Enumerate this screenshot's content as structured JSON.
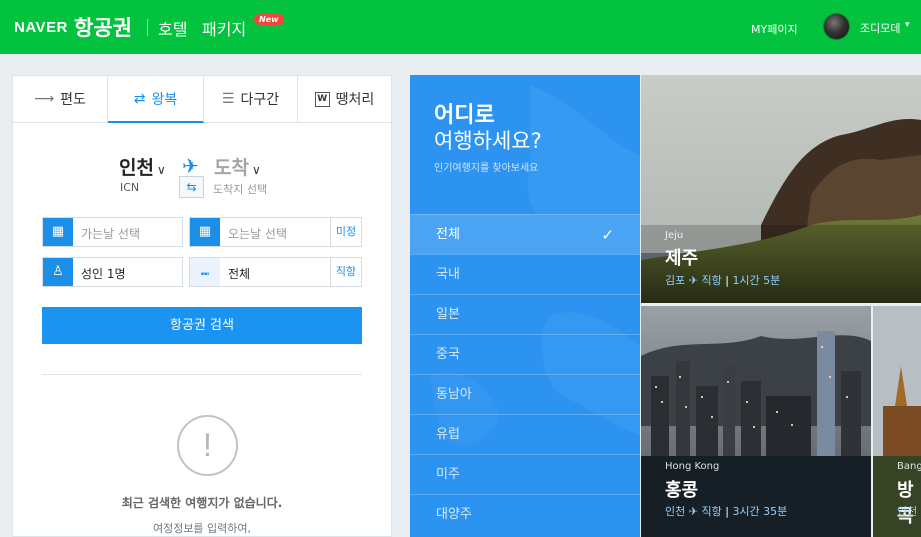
{
  "header": {
    "logo": "NAVER",
    "service": "항공권",
    "nav": [
      "호텔",
      "패키지"
    ],
    "new_badge": "New",
    "mypage": "MY페이지",
    "user": "조디모데"
  },
  "tabs": [
    {
      "label": "편도",
      "icon": "arrow-right-icon"
    },
    {
      "label": "왕복",
      "icon": "round-trip-icon"
    },
    {
      "label": "다구간",
      "icon": "multi-route-icon"
    },
    {
      "label": "땡처리",
      "icon": "w-badge-icon"
    }
  ],
  "route": {
    "from": "인천",
    "from_code": "ICN",
    "to": "도착",
    "to_hint": "도착지 선택"
  },
  "fields": {
    "depart_placeholder": "가는날 선택",
    "return_placeholder": "오는날 선택",
    "return_suffix": "미정",
    "passengers": "성인 1명",
    "seat_class": "전체",
    "seat_suffix": "직항"
  },
  "search_button": "항공권 검색",
  "empty": {
    "icon": "!",
    "title": "최근 검색한 여행지가 없습니다.",
    "subtitle": "여정정보를 입력하여,"
  },
  "destinations": {
    "title_line1": "어디로",
    "title_line2": "여행하세요?",
    "subtitle": "인기여행지를 찾아보세요",
    "items": [
      "전체",
      "국내",
      "일본",
      "중국",
      "동남아",
      "유럽",
      "미주",
      "대양주"
    ],
    "selected": "전체"
  },
  "tiles": [
    {
      "en": "Jeju",
      "city": "제주",
      "from": "김포",
      "direct": "직항",
      "duration": "1시간 5분"
    },
    {
      "en": "Hong Kong",
      "city": "홍콩",
      "from": "인천",
      "direct": "직항",
      "duration": "3시간 35분"
    },
    {
      "en": "Bangkok",
      "city": "방콕",
      "from": "인천"
    }
  ],
  "colors": {
    "brand_green": "#03c33e",
    "accent_blue": "#1b8fe8"
  }
}
